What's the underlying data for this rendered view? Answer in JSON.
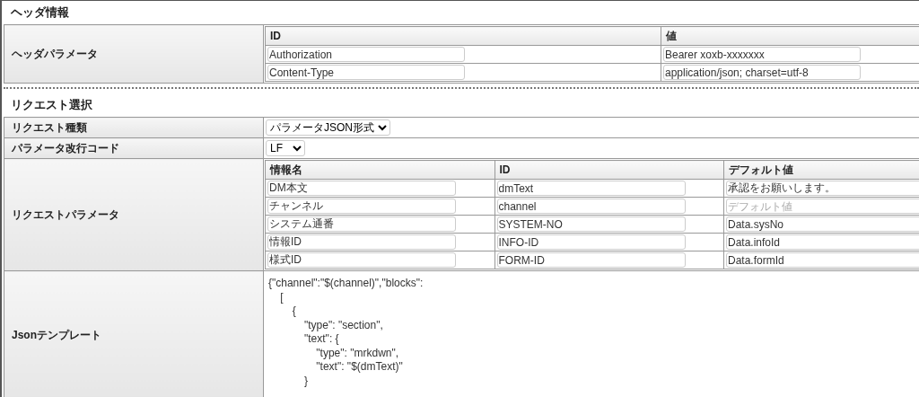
{
  "header_section": {
    "title": "ヘッダ情報",
    "label": "ヘッダパラメータ",
    "columns": [
      "ID",
      "値"
    ],
    "rows": [
      {
        "id": "Authorization",
        "value": "Bearer xoxb-xxxxxxx"
      },
      {
        "id": "Content-Type",
        "value": "application/json; charset=utf-8"
      }
    ]
  },
  "request_section": {
    "title": "リクエスト選択",
    "request_type": {
      "label": "リクエスト種類",
      "value": "パラメータJSON形式"
    },
    "newline_code": {
      "label": "パラメータ改行コード",
      "value": "LF"
    },
    "params": {
      "label": "リクエストパラメータ",
      "columns": [
        "情報名",
        "ID",
        "デフォルト値"
      ],
      "rows": [
        {
          "name": "DM本文",
          "id": "dmText",
          "default": "承認をお願いします。"
        },
        {
          "name": "チャンネル",
          "id": "channel",
          "default_placeholder": "デフォルト値"
        },
        {
          "name": "システム通番",
          "id": "SYSTEM-NO",
          "default": "Data.sysNo"
        },
        {
          "name": "情報ID",
          "id": "INFO-ID",
          "default": "Data.infoId"
        },
        {
          "name": "様式ID",
          "id": "FORM-ID",
          "default": "Data.formId"
        }
      ]
    },
    "json_template": {
      "label": "Jsonテンプレート",
      "value": "{\"channel\":\"$(channel)\",\"blocks\":\n\t[\n\t\t{\n\t\t\t\"type\": \"section\",\n\t\t\t\"text\": {\n\t\t\t\t\"type\": \"mrkdwn\",\n\t\t\t\t\"text\": \"$(dmText)\"\n\t\t\t}"
    }
  }
}
